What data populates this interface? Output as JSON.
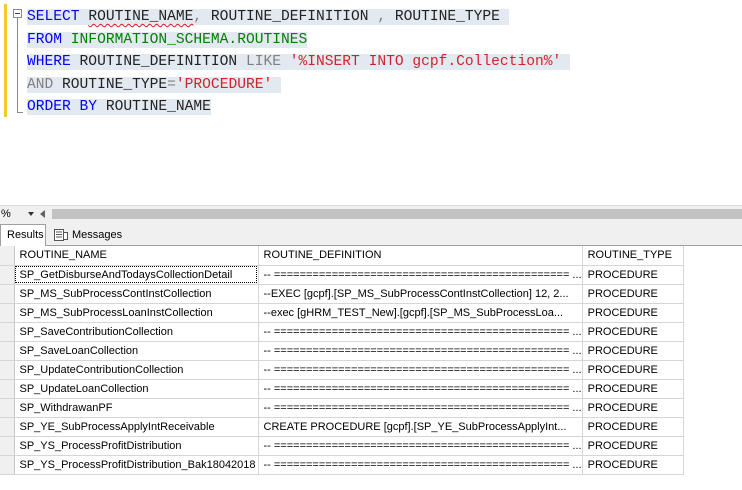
{
  "editor": {
    "lines": [
      [
        {
          "t": "SELECT",
          "c": "kw"
        },
        {
          "t": " ",
          "c": "id"
        },
        {
          "t": "ROUTINE_NAME",
          "c": "id",
          "squig": true
        },
        {
          "t": ",",
          "c": "op"
        },
        {
          "t": " ROUTINE_DEFINITION ",
          "c": "id"
        },
        {
          "t": ",",
          "c": "op"
        },
        {
          "t": " ROUTINE_TYPE ",
          "c": "id"
        }
      ],
      [
        {
          "t": "FROM",
          "c": "kw"
        },
        {
          "t": " ",
          "c": "id"
        },
        {
          "t": "INFORMATION_SCHEMA.ROUTINES",
          "c": "sys"
        }
      ],
      [
        {
          "t": "WHERE",
          "c": "kw"
        },
        {
          "t": " ROUTINE_DEFINITION ",
          "c": "id"
        },
        {
          "t": "LIKE",
          "c": "op"
        },
        {
          "t": " ",
          "c": "id"
        },
        {
          "t": "'%INSERT INTO gcpf.Collection%'",
          "c": "str"
        },
        {
          "t": " ",
          "c": "id"
        }
      ],
      [
        {
          "t": "AND",
          "c": "op"
        },
        {
          "t": " ROUTINE_TYPE",
          "c": "id"
        },
        {
          "t": "=",
          "c": "op"
        },
        {
          "t": "'PROCEDURE'",
          "c": "str"
        },
        {
          "t": " ",
          "c": "id"
        }
      ],
      [
        {
          "t": "ORDER BY",
          "c": "kw"
        },
        {
          "t": " ROUTINE_NAME",
          "c": "id"
        }
      ]
    ]
  },
  "status": {
    "zoom": "%"
  },
  "tabs": {
    "results": "Results",
    "messages": "Messages"
  },
  "grid": {
    "columns": [
      "ROUTINE_NAME",
      "ROUTINE_DEFINITION",
      "ROUTINE_TYPE"
    ],
    "rows": [
      [
        "SP_GetDisburseAndTodaysCollectionDetail",
        "-- ==============================================  ...",
        "PROCEDURE"
      ],
      [
        "SP_MS_SubProcessContInstCollection",
        "--EXEC [gcpf].[SP_MS_SubProcessContInstCollection] 12, 2...",
        "PROCEDURE"
      ],
      [
        "SP_MS_SubProcessLoanInstCollection",
        "--exec [gHRM_TEST_New].[gcpf].[SP_MS_SubProcessLoa...",
        "PROCEDURE"
      ],
      [
        "SP_SaveContributionCollection",
        "-- ==============================================  ...",
        "PROCEDURE"
      ],
      [
        "SP_SaveLoanCollection",
        "-- ==============================================  ...",
        "PROCEDURE"
      ],
      [
        "SP_UpdateContributionCollection",
        "-- ==============================================  ...",
        "PROCEDURE"
      ],
      [
        "SP_UpdateLoanCollection",
        "-- ==============================================  ...",
        "PROCEDURE"
      ],
      [
        "SP_WithdrawanPF",
        "-- ==============================================  ...",
        "PROCEDURE"
      ],
      [
        "SP_YE_SubProcessApplyIntReceivable",
        "CREATE PROCEDURE [gcpf].[SP_YE_SubProcessApplyInt...",
        "PROCEDURE"
      ],
      [
        "SP_YS_ProcessProfitDistribution",
        "-- ==============================================  ...",
        "PROCEDURE"
      ],
      [
        "SP_YS_ProcessProfitDistribution_Bak18042018",
        "-- ==============================================  ...",
        "PROCEDURE"
      ]
    ]
  }
}
